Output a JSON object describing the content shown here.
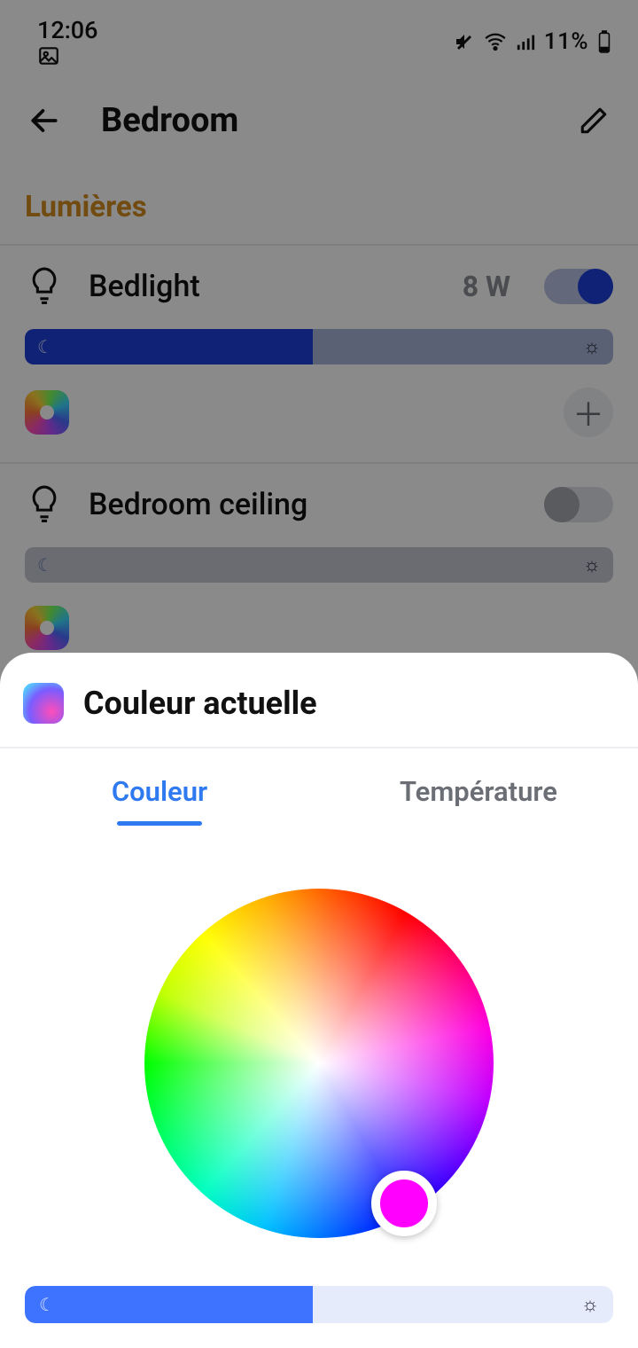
{
  "status": {
    "time": "12:06",
    "battery_text": "11%"
  },
  "header": {
    "title": "Bedroom"
  },
  "section_lights_label": "Lumières",
  "lights": [
    {
      "name": "Bedlight",
      "power_text": "8 W",
      "on": true,
      "brightness_pct": 49
    },
    {
      "name": "Bedroom ceiling",
      "power_text": "",
      "on": false,
      "brightness_pct": 0
    }
  ],
  "sheet": {
    "title": "Couleur actuelle",
    "tabs": {
      "color": "Couleur",
      "temperature": "Température"
    },
    "active_tab": "color",
    "picker_color": "#ff00ff",
    "slider_pct": 49
  }
}
